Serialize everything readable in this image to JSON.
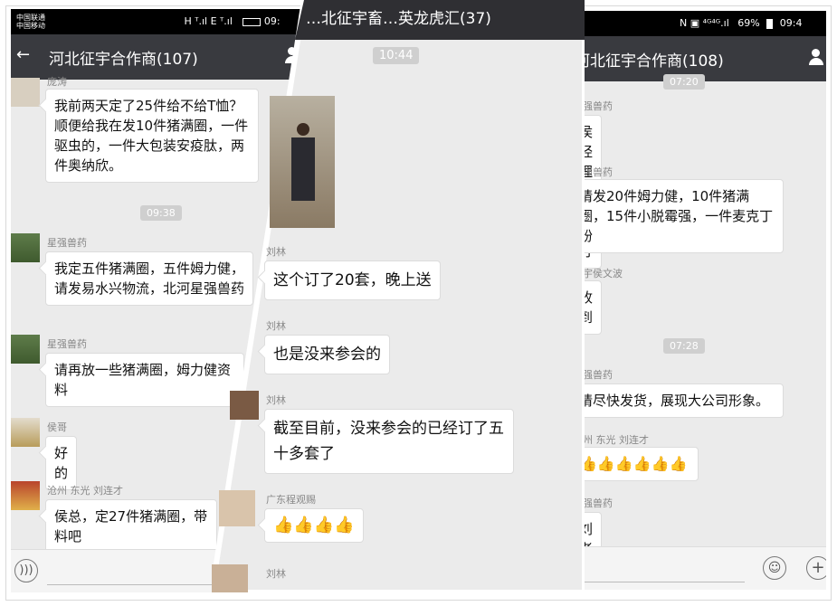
{
  "left": {
    "status": {
      "carrier1": "中国联通",
      "carrier2": "中国移动",
      "signal": "H ᵀ.ıl E ᵀ.ıl",
      "time": "09:"
    },
    "title": "河北征宇合作商(107)",
    "messages": [
      {
        "sender": "庞涛",
        "text": "我前两天定了25件给不给T恤？顺便给我在发10件猪满圈，一件驱虫的，一件大包装安疫肽，两件奥纳欣。"
      },
      {
        "sender": "星强兽药",
        "text": "我定五件猪满圈，五件姆力健，请发易水兴物流，北河星强兽药"
      },
      {
        "sender": "星强兽药",
        "text": "请再放一些猪满圈，姆力健资料"
      },
      {
        "sender": "侯哥",
        "text": "好的"
      },
      {
        "sender": "沧州 东光   刘连才",
        "text": "侯总，定27件猪满圈，带料吧"
      }
    ],
    "time1": "09:38"
  },
  "middle": {
    "title": "…北征宇畜…英龙虎汇(37)",
    "time": "10:44",
    "messages": [
      {
        "sender": "刘林",
        "text": "这个订了20套，晚上送"
      },
      {
        "sender": "刘林",
        "text": "也是没来参会的"
      },
      {
        "sender": "刘林",
        "text": "截至目前，没来参会的已经订了五十多套了"
      },
      {
        "sender": "广东程观赐",
        "text": "👍👍👍👍"
      },
      {
        "sender": "刘林",
        "text": ""
      }
    ]
  },
  "right": {
    "status": {
      "icons": "N ▣ ⁴ᴳ⁴ᴳ.ıl",
      "battery": "69%",
      "time": "09:4"
    },
    "title": "河北征宇合作商(108)",
    "time0": "07:20",
    "time1": "07:28",
    "messages": [
      {
        "sender": "星强兽药",
        "text": "侯经理货款已打"
      },
      {
        "sender": "星强兽药",
        "text": "请发20件姆力健，10件猪满圈，15件小脱霉强，一件麦克丁粉"
      },
      {
        "sender": "征宇侯文波",
        "text": "收到"
      },
      {
        "sender": "星强兽药",
        "text": "请尽快发货，展现大公司形象。"
      },
      {
        "sender": "沧州 东光   刘连才",
        "text": "👍👍👍👍👍👍"
      },
      {
        "sender": "星强兽药",
        "text": "刘老板好"
      }
    ]
  },
  "colors": {
    "titlebar": "#393a3f",
    "chat_bg": "#ebebeb",
    "bubble": "#ffffff",
    "time_badge": "#cfcfcf"
  }
}
